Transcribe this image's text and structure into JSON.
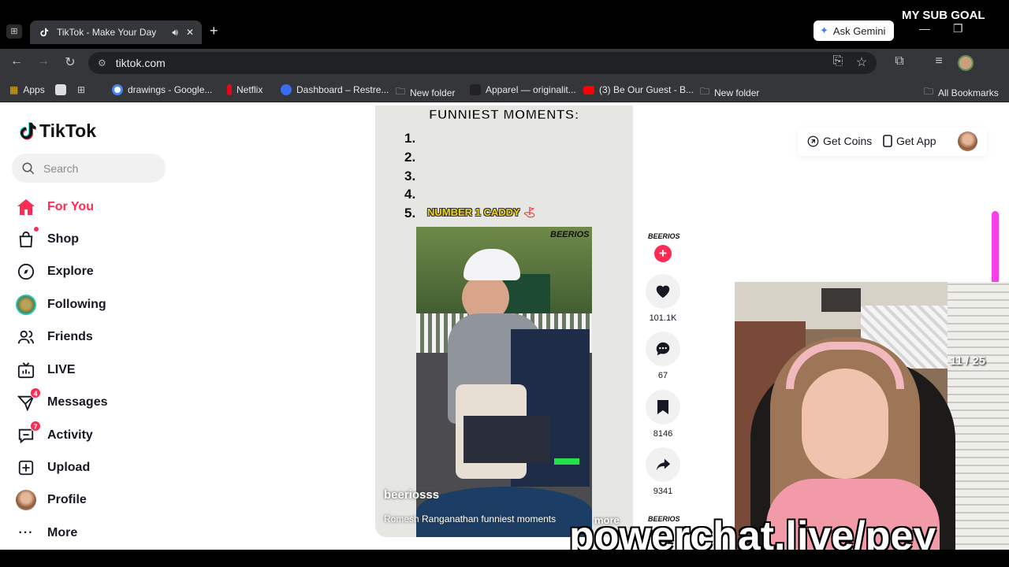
{
  "browser": {
    "tab_title": "TikTok - Make Your Day",
    "ask_gemini": "Ask Gemini",
    "url": "tiktok.com",
    "bookmarks": [
      "Apps",
      "drawings - Google...",
      "Netflix",
      "Dashboard – Restre...",
      "New folder",
      "Apparel — originalit...",
      "(3) Be Our Guest - B...",
      "New folder",
      "All Bookmarks"
    ]
  },
  "overlay": {
    "sub_goal": "MY SUB GOAL",
    "counter": "11 / 25",
    "promo": "powerchat.live/pey"
  },
  "tiktok": {
    "logo": "TikTok",
    "search_placeholder": "Search",
    "nav": [
      {
        "label": "For You",
        "icon": "home-icon",
        "active": true
      },
      {
        "label": "Shop",
        "icon": "shop-icon"
      },
      {
        "label": "Explore",
        "icon": "compass-icon"
      },
      {
        "label": "Following",
        "icon": "following-avatar-icon"
      },
      {
        "label": "Friends",
        "icon": "friends-icon"
      },
      {
        "label": "LIVE",
        "icon": "live-icon"
      },
      {
        "label": "Messages",
        "icon": "messages-icon",
        "badge": "4"
      },
      {
        "label": "Activity",
        "icon": "activity-icon",
        "badge": "7"
      },
      {
        "label": "Upload",
        "icon": "upload-icon"
      },
      {
        "label": "Profile",
        "icon": "profile-avatar-icon"
      },
      {
        "label": "More",
        "icon": "more-icon"
      }
    ],
    "get_coins": "Get Coins",
    "get_app": "Get App",
    "video": {
      "heading": "FUNNIEST MOMENTS:",
      "list": [
        "1.",
        "2.",
        "3.",
        "4.",
        "5."
      ],
      "item5": "NUMBER 1 CADDY",
      "watermark": "BEERIOS",
      "username": "beeriosss",
      "caption": "Romesh Ranganathan funniest moments",
      "more": "more"
    },
    "actions": {
      "likes": "101.1K",
      "comments": "67",
      "saves": "8146",
      "shares": "9341"
    },
    "accent": "#fe2c55"
  }
}
